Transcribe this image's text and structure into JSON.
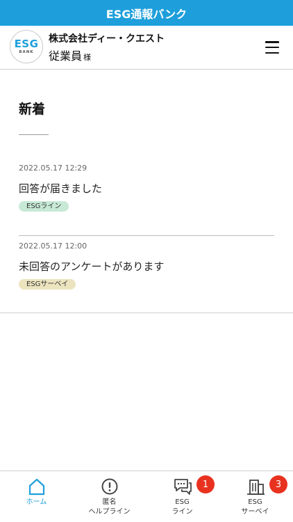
{
  "app": {
    "title": "ESG通報バンク"
  },
  "header": {
    "logo": {
      "main": "ESG",
      "sub": "BANK"
    },
    "company_name": "株式会社ディー・クエスト",
    "user_name": "従業員",
    "user_honorific": "様",
    "menu_icon": "hamburger-menu-icon"
  },
  "main": {
    "section_title": "新着",
    "news": [
      {
        "date": "2022.05.17 12:29",
        "text": "回答が届きました",
        "tag": "ESGライン",
        "tag_color": "#c7e9d6"
      },
      {
        "date": "2022.05.17 12:00",
        "text": "未回答のアンケートがあります",
        "tag": "ESGサーベイ",
        "tag_color": "#ece4bf"
      }
    ]
  },
  "bottom_nav": {
    "items": [
      {
        "label_1": "ホーム",
        "label_2": "",
        "icon": "home-icon",
        "active": true,
        "badge": ""
      },
      {
        "label_1": "匿名",
        "label_2": "ヘルプライン",
        "icon": "exclamation-circle-icon",
        "active": false,
        "badge": ""
      },
      {
        "label_1": "ESG",
        "label_2": "ライン",
        "icon": "chat-bubbles-icon",
        "active": false,
        "badge": "1"
      },
      {
        "label_1": "ESG",
        "label_2": "サーベイ",
        "icon": "building-icon",
        "active": false,
        "badge": "3"
      }
    ]
  },
  "colors": {
    "accent": "#1e9fdb",
    "badge": "#e8321f"
  }
}
